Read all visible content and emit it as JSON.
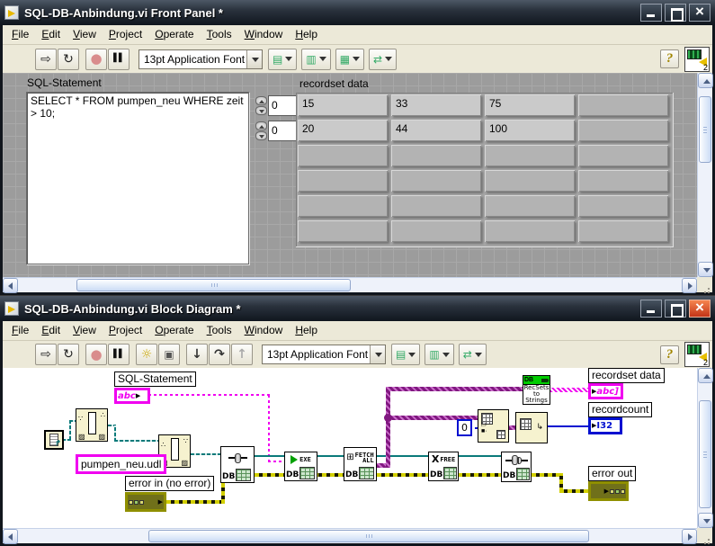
{
  "colors": {
    "wire-string": "#f000f0",
    "wire-path": "#0b7a7a",
    "wire-refnum": "#0b7a7a",
    "wire-variant": "#801880",
    "wire-error": "#d2cf00",
    "wire-int": "#0010d0",
    "db-green": "#00cc00",
    "node-yellow": "#f6f2cf",
    "close-red": "#c33417"
  },
  "front_panel": {
    "title": "SQL-DB-Anbindung.vi Front Panel *",
    "menu": [
      "File",
      "Edit",
      "View",
      "Project",
      "Operate",
      "Tools",
      "Window",
      "Help"
    ],
    "toolbar": {
      "buttons": [
        {
          "name": "run",
          "glyph": "⇨"
        },
        {
          "name": "run-continuously",
          "glyph": "↻"
        },
        {
          "name": "abort",
          "glyph": "●"
        },
        {
          "name": "pause",
          "glyph": "▌▌"
        }
      ],
      "font_selector": "13pt Application Font",
      "dropdowns": [
        {
          "name": "align-objects",
          "glyph": "▤"
        },
        {
          "name": "distribute-objects",
          "glyph": "▥"
        },
        {
          "name": "resize-objects",
          "glyph": "▦"
        },
        {
          "name": "reorder-objects",
          "glyph": "⇄"
        }
      ],
      "help": "?",
      "vi_badge": "2"
    },
    "sql": {
      "label": "SQL-Statement",
      "text": "SELECT * FROM pumpen_neu WHERE zeit > 10;"
    },
    "index_controls": [
      {
        "value": "0"
      },
      {
        "value": "0"
      }
    ],
    "recordset": {
      "label": "recordset data",
      "rows": [
        [
          "15",
          "33",
          "75",
          ""
        ],
        [
          "20",
          "44",
          "100",
          ""
        ],
        [
          "",
          "",
          "",
          ""
        ],
        [
          "",
          "",
          "",
          ""
        ],
        [
          "",
          "",
          "",
          ""
        ],
        [
          "",
          "",
          "",
          ""
        ]
      ]
    }
  },
  "block_diagram": {
    "title": "SQL-DB-Anbindung.vi Block Diagram *",
    "menu": [
      "File",
      "Edit",
      "View",
      "Project",
      "Operate",
      "Tools",
      "Window",
      "Help"
    ],
    "toolbar": {
      "buttons": [
        {
          "name": "run",
          "glyph": "⇨"
        },
        {
          "name": "run-continuously",
          "glyph": "↻"
        },
        {
          "name": "abort",
          "glyph": "●"
        },
        {
          "name": "pause",
          "glyph": "▌▌"
        },
        {
          "name": "highlight-execution",
          "glyph": "☼"
        },
        {
          "name": "retain-wire-values",
          "glyph": "▣"
        },
        {
          "name": "step-into",
          "glyph": "↓"
        },
        {
          "name": "step-over",
          "glyph": "↷"
        },
        {
          "name": "step-out",
          "glyph": "↑"
        }
      ],
      "font_selector": "13pt Application Font",
      "dropdowns": [
        {
          "name": "align-objects",
          "glyph": "▤"
        },
        {
          "name": "distribute-objects",
          "glyph": "▥"
        },
        {
          "name": "reorder-objects",
          "glyph": "⇄"
        }
      ],
      "help": "?",
      "vi_badge": "2"
    },
    "nodes": {
      "sql_label": "SQL-Statement",
      "sql_terminal": "abc",
      "udl_constant": "pumpen_neu.udl",
      "error_in_label": "error in (no error)",
      "db_label": "DB",
      "exe_label": "EXE",
      "fetch_label_1": "FETCH",
      "fetch_label_2": "ALL",
      "free_label": "FREE",
      "recsets_header": "DB",
      "recsets_lines": [
        "RecSets",
        "to",
        "Strings"
      ],
      "index_constant": "0",
      "recordset_label": "recordset data",
      "recordset_terminal": "abc]",
      "recordcount_label": "recordcount",
      "recordcount_terminal": "I32",
      "error_out_label": "error out"
    }
  }
}
